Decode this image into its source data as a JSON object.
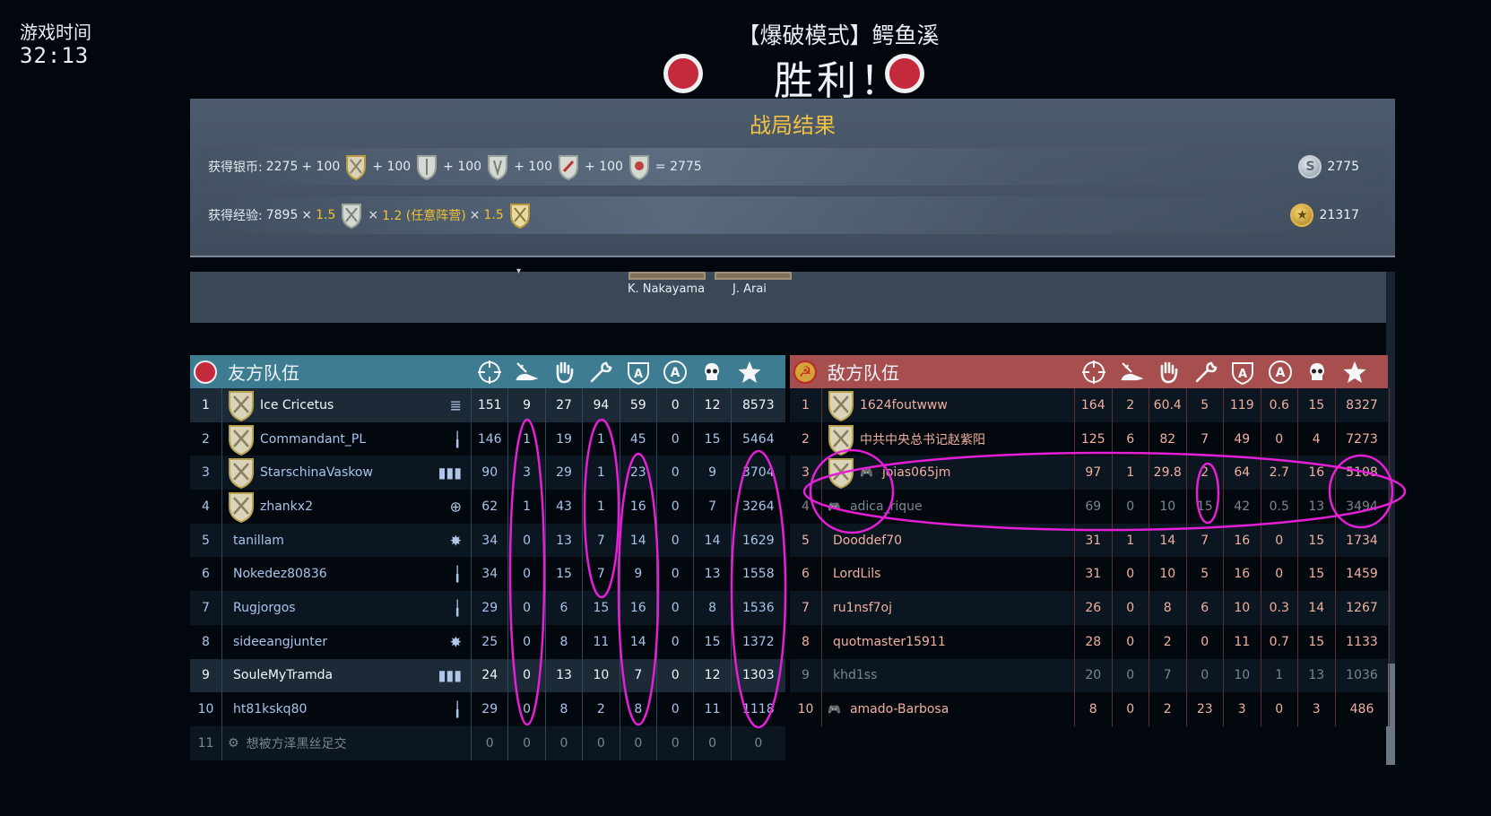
{
  "timer": {
    "label": "游戏时间",
    "value": "32:13"
  },
  "mode_title": "【爆破模式】鳄鱼溪",
  "result": "胜利！",
  "summary": {
    "title": "战局结果",
    "silver": {
      "label": "获得银币:",
      "base": "2275",
      "bonuses": [
        "+ 100",
        "+ 100",
        "+ 100",
        "+ 100",
        "+ 100"
      ],
      "equals": "= 2775",
      "total": "2775",
      "icon": "silver-coin-icon"
    },
    "exp": {
      "label": "获得经验:",
      "base": "7895",
      "m1": "1.5",
      "m2": "1.2 (任意阵营)",
      "m3": "1.5",
      "times": "×",
      "total": "21317",
      "icon": "gold-coin-icon"
    }
  },
  "commanders": [
    "K. Nakayama",
    "J. Arai"
  ],
  "friendly": {
    "title": "友方队伍",
    "headers": [
      "crosshair-icon",
      "plane-icon",
      "hand-icon",
      "wrench-icon",
      "shield-a-icon",
      "a-circle-icon",
      "skull-icon",
      "star-icon"
    ],
    "rows": [
      {
        "rank": "1",
        "name": "Ice Cricetus",
        "cls": "≣",
        "stats": [
          "151",
          "9",
          "27",
          "94",
          "59",
          "0",
          "12",
          "8573"
        ]
      },
      {
        "rank": "2",
        "name": "Commandant_PL",
        "cls": "╽",
        "stats": [
          "146",
          "1",
          "19",
          "1",
          "45",
          "0",
          "15",
          "5464"
        ]
      },
      {
        "rank": "3",
        "name": "StarschinaVaskow",
        "cls": "▮▮▮",
        "stats": [
          "90",
          "3",
          "29",
          "1",
          "23",
          "0",
          "9",
          "3704"
        ]
      },
      {
        "rank": "4",
        "name": "zhankx2",
        "cls": "⊕",
        "stats": [
          "62",
          "1",
          "43",
          "1",
          "16",
          "0",
          "7",
          "3264"
        ]
      },
      {
        "rank": "5",
        "name": "tanillam",
        "cls": "✸",
        "stats": [
          "34",
          "0",
          "13",
          "7",
          "14",
          "0",
          "14",
          "1629"
        ]
      },
      {
        "rank": "6",
        "name": "Nokedez80836",
        "cls": "╽",
        "stats": [
          "34",
          "0",
          "15",
          "7",
          "9",
          "0",
          "13",
          "1558"
        ]
      },
      {
        "rank": "7",
        "name": "Rugjorgos",
        "cls": "╽",
        "stats": [
          "29",
          "0",
          "6",
          "15",
          "16",
          "0",
          "8",
          "1536"
        ]
      },
      {
        "rank": "8",
        "name": "sideeangjunter",
        "cls": "✸",
        "stats": [
          "25",
          "0",
          "8",
          "11",
          "14",
          "0",
          "15",
          "1372"
        ]
      },
      {
        "rank": "9",
        "name": "SouleMyTramda",
        "cls": "▮▮▮",
        "stats": [
          "24",
          "0",
          "13",
          "10",
          "7",
          "0",
          "12",
          "1303"
        ]
      },
      {
        "rank": "10",
        "name": "ht81kskq80",
        "cls": "╽",
        "stats": [
          "29",
          "0",
          "8",
          "2",
          "8",
          "0",
          "11",
          "1118"
        ]
      },
      {
        "rank": "11",
        "name": "想被方泽黑丝足交",
        "cls": "",
        "stats": [
          "0",
          "0",
          "0",
          "0",
          "0",
          "0",
          "0",
          "0"
        ]
      }
    ]
  },
  "enemy": {
    "title": "敌方队伍",
    "rows": [
      {
        "rank": "1",
        "name": "1624foutwww",
        "stats": [
          "164",
          "2",
          "60.4",
          "5",
          "119",
          "0.6",
          "15",
          "8327"
        ]
      },
      {
        "rank": "2",
        "name": "中共中央总书记赵紫阳",
        "stats": [
          "125",
          "6",
          "82",
          "7",
          "49",
          "0",
          "4",
          "7273"
        ]
      },
      {
        "rank": "3",
        "name": "joias065jm",
        "stats": [
          "97",
          "1",
          "29.8",
          "2",
          "64",
          "2.7",
          "16",
          "5108"
        ]
      },
      {
        "rank": "4",
        "name": "adica_rique",
        "stats": [
          "69",
          "0",
          "10",
          "15",
          "42",
          "0.5",
          "13",
          "3494"
        ]
      },
      {
        "rank": "5",
        "name": "Dooddef70",
        "stats": [
          "31",
          "1",
          "14",
          "7",
          "16",
          "0",
          "15",
          "1734"
        ]
      },
      {
        "rank": "6",
        "name": "LordLils",
        "stats": [
          "31",
          "0",
          "10",
          "5",
          "16",
          "0",
          "15",
          "1459"
        ]
      },
      {
        "rank": "7",
        "name": "ru1nsf7oj",
        "stats": [
          "26",
          "0",
          "8",
          "6",
          "10",
          "0.3",
          "14",
          "1267"
        ]
      },
      {
        "rank": "8",
        "name": "quotmaster15911",
        "stats": [
          "28",
          "0",
          "2",
          "0",
          "11",
          "0.7",
          "15",
          "1133"
        ]
      },
      {
        "rank": "9",
        "name": "khd1ss",
        "stats": [
          "20",
          "0",
          "7",
          "0",
          "10",
          "1",
          "13",
          "1036"
        ]
      },
      {
        "rank": "10",
        "name": "amado-Barbosa",
        "stats": [
          "8",
          "0",
          "2",
          "23",
          "3",
          "0",
          "3",
          "486"
        ]
      }
    ]
  },
  "colors": {
    "friendly_header": "#3d7c91",
    "enemy_header": "#a64f4e",
    "gold": "#f3c240",
    "annotation": "#e51fd6"
  }
}
